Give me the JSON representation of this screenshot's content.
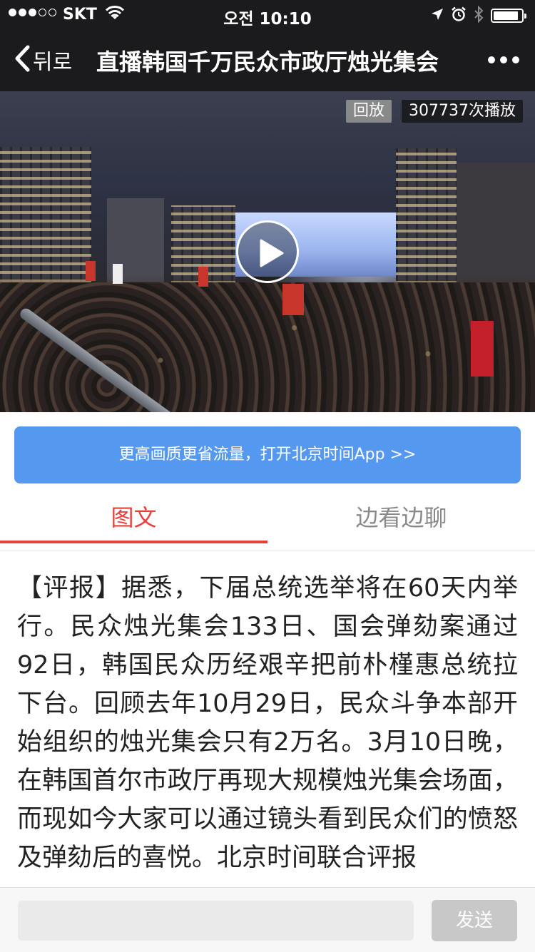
{
  "status_bar": {
    "carrier": "SKT",
    "time": "오전 10:10",
    "signal_bars_filled": 3,
    "signal_bars_total": 5,
    "battery_level": 0.9,
    "icons": [
      "wifi-icon",
      "location-icon",
      "alarm-icon",
      "bluetooth-icon",
      "battery-icon"
    ]
  },
  "nav": {
    "back_label": "뒤로",
    "title": "直播韩国千万民众市政厅烛光集会",
    "more_icon": "more-icon"
  },
  "video": {
    "replay_badge": "回放",
    "play_count": "307737次播放",
    "play_icon": "play-icon"
  },
  "banner": {
    "text": "更高画质更省流量，打开北京时间App >>",
    "color": "#5498f0"
  },
  "tabs": [
    {
      "label": "图文",
      "active": true
    },
    {
      "label": "边看边聊",
      "active": false
    }
  ],
  "article": {
    "text": "【评报】据悉，下届总统选举将在60天内举行。民众烛光集会133日、国会弹劾案通过92日，韩国民众历经艰辛把前朴槿惠总统拉下台。回顾去年10月29日，民众斗争本部开始组织的烛光集会只有2万名。3月10日晚，在韩国首尔市政厅再现大规模烛光集会场面，而现如今大家可以通过镜头看到民众们的愤怒及弹劾后的喜悦。北京时间联合评报"
  },
  "comment_bar": {
    "input_value": "",
    "send_label": "发送"
  },
  "colors": {
    "accent": "#e8413c",
    "nav_bg": "#1b1b1d",
    "send_disabled": "#c8c8c8"
  }
}
